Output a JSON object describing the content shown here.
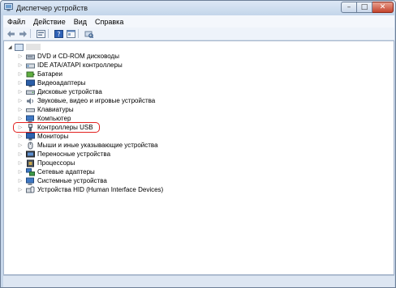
{
  "window": {
    "title": "Диспетчер устройств",
    "title_icon": "device-manager-icon",
    "controls": [
      "minimize",
      "maximize",
      "close"
    ]
  },
  "menu": [
    "Файл",
    "Действие",
    "Вид",
    "Справка"
  ],
  "toolbar": {
    "buttons": [
      "back-icon",
      "forward-icon",
      "show-hidden-icon",
      "help-icon",
      "properties-icon",
      "scan-hardware-icon"
    ]
  },
  "tree": {
    "root": {
      "icon": "computer-icon",
      "expanded": true
    },
    "items": [
      {
        "label": "DVD и CD-ROM дисководы",
        "icon": "dvd-drive-icon"
      },
      {
        "label": "IDE ATA/ATAPI контроллеры",
        "icon": "ide-controller-icon"
      },
      {
        "label": "Батареи",
        "icon": "battery-icon"
      },
      {
        "label": "Видеоадаптеры",
        "icon": "display-adapter-icon"
      },
      {
        "label": "Дисковые устройства",
        "icon": "disk-drive-icon"
      },
      {
        "label": "Звуковые, видео и игровые устройства",
        "icon": "sound-icon"
      },
      {
        "label": "Клавиатуры",
        "icon": "keyboard-icon"
      },
      {
        "label": "Компьютер",
        "icon": "computer-icon"
      },
      {
        "label": "Контроллеры USB",
        "icon": "usb-icon",
        "highlighted": true
      },
      {
        "label": "Мониторы",
        "icon": "monitor-icon"
      },
      {
        "label": "Мыши и иные указывающие устройства",
        "icon": "mouse-icon"
      },
      {
        "label": "Переносные устройства",
        "icon": "portable-device-icon"
      },
      {
        "label": "Процессоры",
        "icon": "processor-icon"
      },
      {
        "label": "Сетевые адаптеры",
        "icon": "network-adapter-icon"
      },
      {
        "label": "Системные устройства",
        "icon": "system-device-icon"
      },
      {
        "label": "Устройства HID (Human Interface Devices)",
        "icon": "hid-icon"
      }
    ]
  },
  "colors": {
    "highlight": "#e2201e",
    "title_gradient_top": "#dde8f5",
    "title_gradient_bottom": "#c3d5ea"
  }
}
